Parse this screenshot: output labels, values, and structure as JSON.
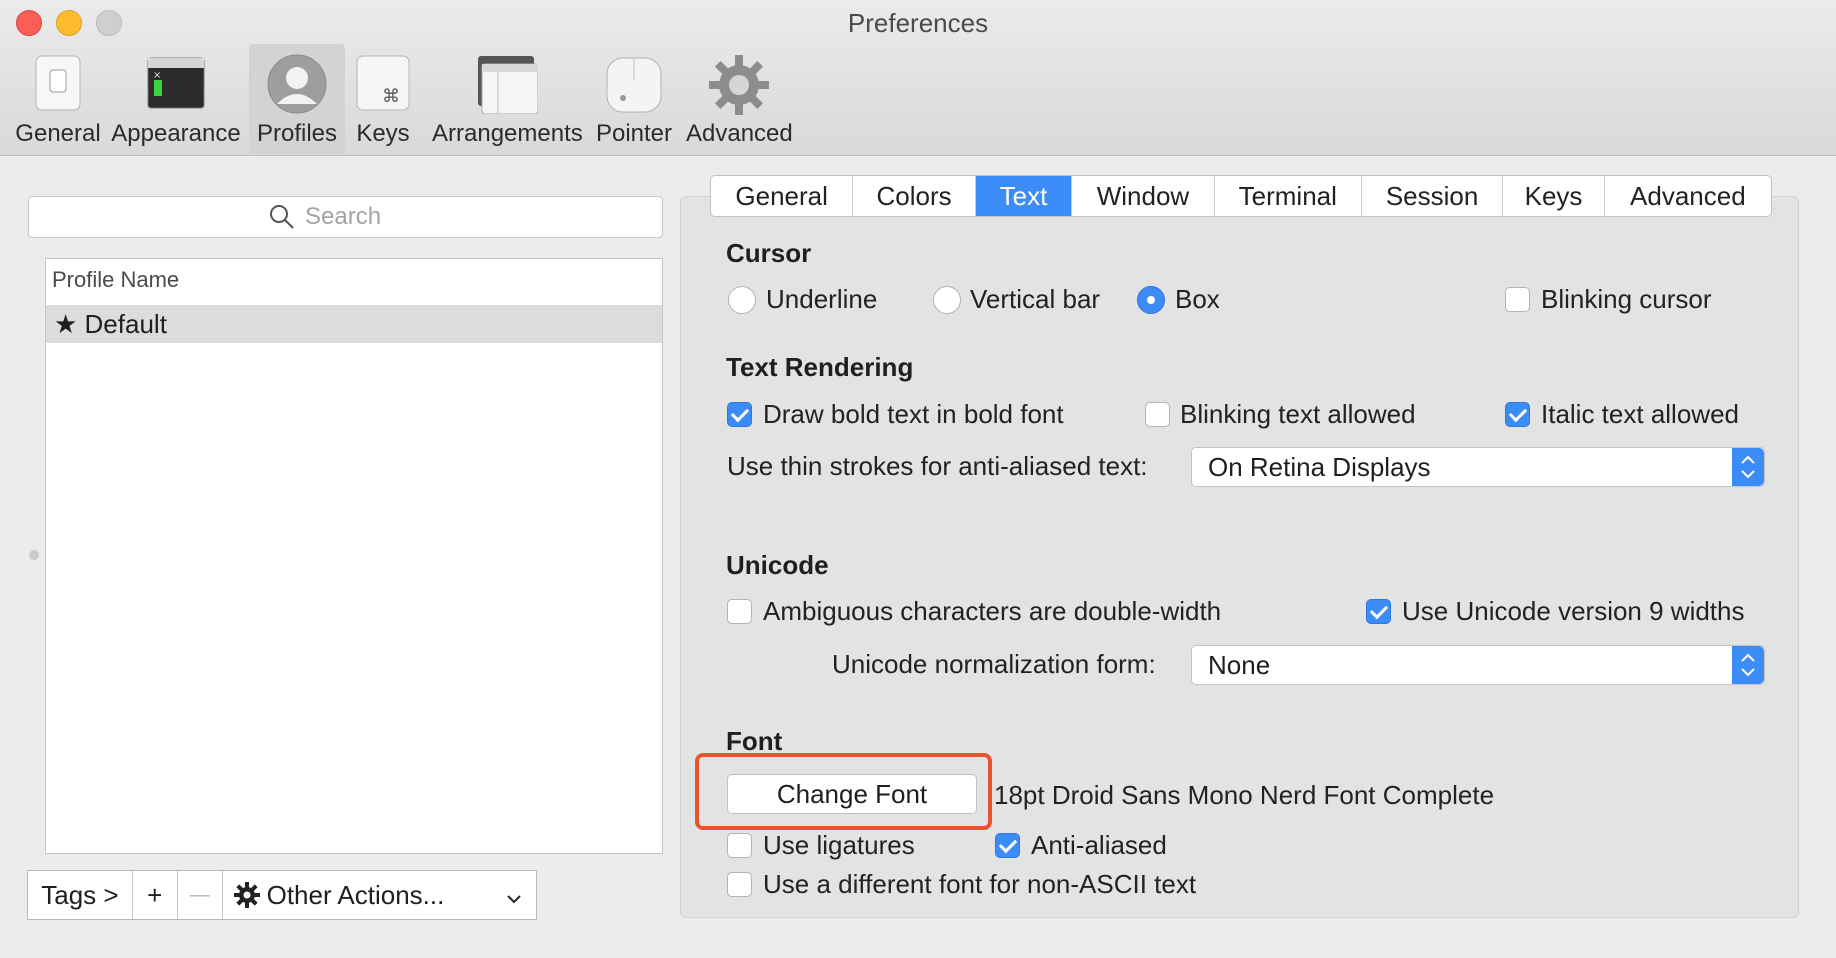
{
  "window": {
    "title": "Preferences"
  },
  "toolbar": {
    "items": [
      {
        "label": "General",
        "icon": "switch-icon"
      },
      {
        "label": "Appearance",
        "icon": "window-icon"
      },
      {
        "label": "Profiles",
        "icon": "profile-silhouette-icon",
        "selected": true
      },
      {
        "label": "Keys",
        "icon": "command-key-icon"
      },
      {
        "label": "Arrangements",
        "icon": "windows-stack-icon"
      },
      {
        "label": "Pointer",
        "icon": "mouse-icon"
      },
      {
        "label": "Advanced",
        "icon": "gear-icon"
      }
    ]
  },
  "sidebar": {
    "search_placeholder": "Search",
    "list_header": "Profile Name",
    "profiles": [
      {
        "name": "★ Default"
      }
    ],
    "bottom": {
      "tags_label": "Tags >",
      "add_label": "+",
      "remove_label": "—",
      "other_actions_label": "Other Actions..."
    }
  },
  "tabs": {
    "items": [
      "General",
      "Colors",
      "Text",
      "Window",
      "Terminal",
      "Session",
      "Keys",
      "Advanced"
    ],
    "active": "Text"
  },
  "cursor": {
    "title": "Cursor",
    "options": [
      "Underline",
      "Vertical bar",
      "Box"
    ],
    "selected": "Box",
    "blinking_label": "Blinking cursor",
    "blinking_checked": false
  },
  "text_rendering": {
    "title": "Text Rendering",
    "bold_label": "Draw bold text in bold font",
    "bold_checked": true,
    "blinking_text_label": "Blinking text allowed",
    "blinking_text_checked": false,
    "italic_label": "Italic text allowed",
    "italic_checked": true,
    "thin_strokes_label": "Use thin strokes for anti-aliased text:",
    "thin_strokes_value": "On Retina Displays"
  },
  "unicode": {
    "title": "Unicode",
    "ambiguous_label": "Ambiguous characters are double-width",
    "ambiguous_checked": false,
    "unicode9_label": "Use Unicode version 9 widths",
    "unicode9_checked": true,
    "normalization_label": "Unicode normalization form:",
    "normalization_value": "None"
  },
  "font": {
    "title": "Font",
    "change_button": "Change Font",
    "current_font": "18pt Droid Sans Mono Nerd Font Complete",
    "ligatures_label": "Use ligatures",
    "ligatures_checked": false,
    "antialiased_label": "Anti-aliased",
    "antialiased_checked": true,
    "non_ascii_label": "Use a different font for non-ASCII text",
    "non_ascii_checked": false
  },
  "colors": {
    "accent": "#3c8cf7",
    "highlight": "#e8542f"
  }
}
